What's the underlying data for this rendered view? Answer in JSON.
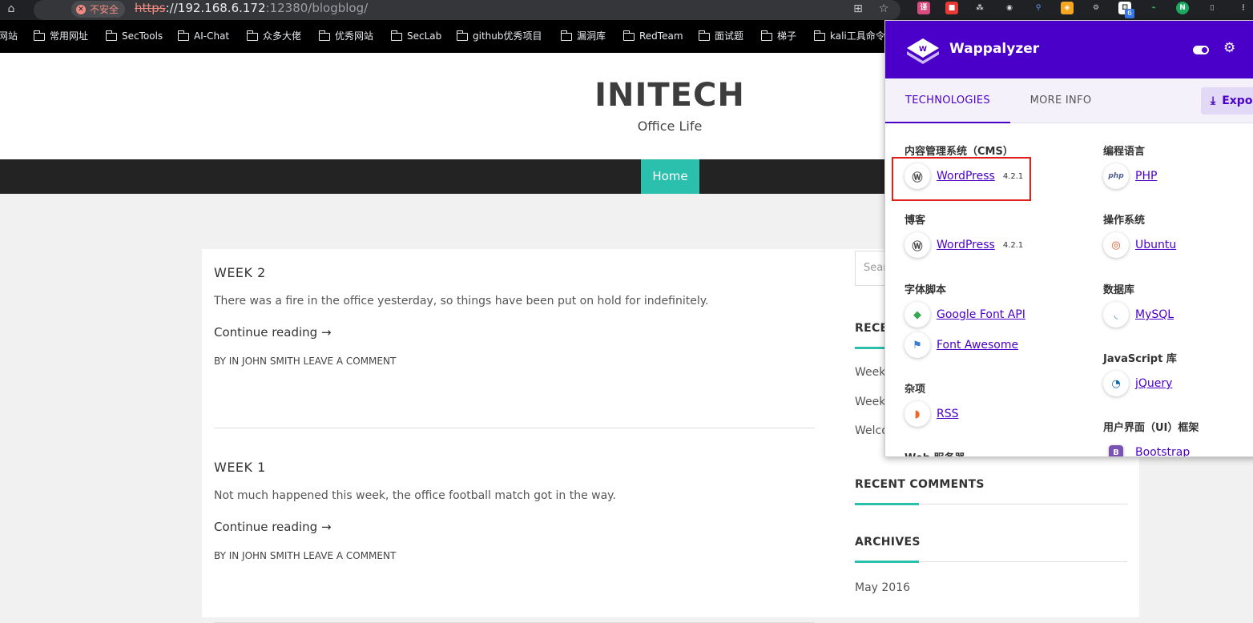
{
  "browser": {
    "security_label": "不安全",
    "url_scheme": "https",
    "url_host": "://192.168.6.172",
    "url_rest": ":12380/blogblog/",
    "bookmarks": [
      "网站",
      "常用网址",
      "SecTools",
      "AI-Chat",
      "众多大佬",
      "优秀网站",
      "SecLab",
      "github优秀项目",
      "漏洞库",
      "RedTeam",
      "面试题",
      "梯子",
      "kali工具命令"
    ],
    "icons": [
      "home-icon",
      "translate-icon",
      "star-icon",
      "menu-icon"
    ],
    "extension_badge": "6"
  },
  "site": {
    "title": "INITECH",
    "tagline": "Office Life",
    "nav_home": "Home"
  },
  "posts": [
    {
      "title": "WEEK 2",
      "excerpt": "There was a fire in the office yesterday, so things have been put on hold for indefinitely.",
      "more": "Continue reading →",
      "meta": "BY IN JOHN SMITH LEAVE A COMMENT"
    },
    {
      "title": "WEEK 1",
      "excerpt": "Not much happened this week, the office football match got in the way.",
      "more": "Continue reading →",
      "meta": "BY IN JOHN SMITH LEAVE A COMMENT"
    }
  ],
  "sidebar": {
    "search_placeholder": "Sear",
    "recent_posts_title": "RECE",
    "recent_posts": [
      "Week",
      "Week",
      "Welco"
    ],
    "recent_comments_title": "RECENT COMMENTS",
    "archives_title": "ARCHIVES",
    "archives": [
      "May 2016"
    ]
  },
  "wappalyzer": {
    "name": "Wappalyzer",
    "tab_technologies": "TECHNOLOGIES",
    "tab_more_info": "MORE INFO",
    "export_label": "Expo",
    "left_column": [
      {
        "category": "内容管理系统（CMS）",
        "items": [
          {
            "name": "WordPress",
            "version": "4.2.1",
            "icon": "wordpress-icon"
          }
        ]
      },
      {
        "category": "博客",
        "items": [
          {
            "name": "WordPress",
            "version": "4.2.1",
            "icon": "wordpress-icon"
          }
        ]
      },
      {
        "category": "字体脚本",
        "items": [
          {
            "name": "Google Font API",
            "version": "",
            "icon": "google-font-icon"
          },
          {
            "name": "Font Awesome",
            "version": "",
            "icon": "font-awesome-icon"
          }
        ]
      },
      {
        "category": "杂项",
        "items": [
          {
            "name": "RSS",
            "version": "",
            "icon": "rss-icon"
          }
        ]
      },
      {
        "category": "Web 服务器",
        "items": []
      }
    ],
    "right_column": [
      {
        "category": "编程语言",
        "items": [
          {
            "name": "PHP",
            "version": "",
            "icon": "php-icon"
          }
        ]
      },
      {
        "category": "操作系统",
        "items": [
          {
            "name": "Ubuntu",
            "version": "",
            "icon": "ubuntu-icon"
          }
        ]
      },
      {
        "category": "数据库",
        "items": [
          {
            "name": "MySQL",
            "version": "",
            "icon": "mysql-icon"
          }
        ]
      },
      {
        "category": "JavaScript 库",
        "items": [
          {
            "name": "jQuery",
            "version": "",
            "icon": "jquery-icon"
          }
        ]
      },
      {
        "category": "用户界面（UI）框架",
        "items": [
          {
            "name": "Bootstrap",
            "version": "",
            "icon": "bootstrap-icon"
          }
        ]
      }
    ]
  },
  "colors": {
    "accent": "#2bbfae",
    "wappalyzer": "#4a00c8",
    "highlight": "#e0201c"
  }
}
